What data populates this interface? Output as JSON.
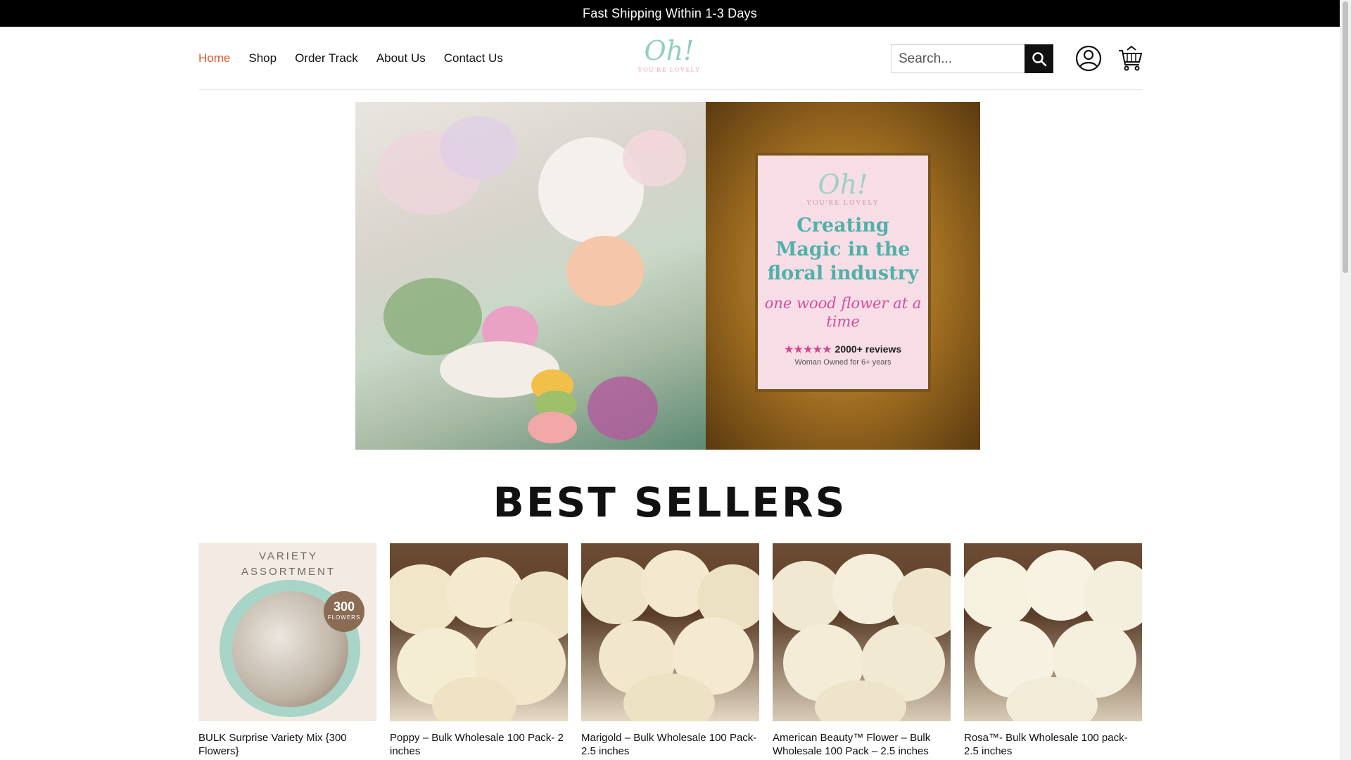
{
  "announcement": "Fast Shipping Within 1-3 Days",
  "nav": {
    "items": [
      {
        "label": "Home"
      },
      {
        "label": "Shop"
      },
      {
        "label": "Order Track"
      },
      {
        "label": "About Us"
      },
      {
        "label": "Contact Us"
      }
    ],
    "active_index": 0,
    "active_color": "#e05a2b"
  },
  "logo": {
    "mark": "Oh!",
    "sub": "YOU'RE LOVELY"
  },
  "search": {
    "placeholder": "Search..."
  },
  "icons": {
    "search": "search-icon",
    "account": "user-circle-icon",
    "cart": "cart-icon"
  },
  "hero": {
    "logo_mark": "Oh!",
    "logo_sub": "YOU'RE LOVELY",
    "headline": "Creating Magic in the floral industry",
    "script": "one wood flower at a time",
    "stars": "★★★★★",
    "reviews": "2000+ reviews",
    "owned": "Woman Owned for 6+ years"
  },
  "best_sellers": {
    "title": "BEST SELLERS",
    "products": [
      {
        "name": "BULK Surprise Variety Mix {300 Flowers}",
        "price": "",
        "badge": "300",
        "badge_sub": "FLOWERS",
        "caption": "VARIETY ASSORTMENT"
      },
      {
        "name": "Poppy – Bulk Wholesale 100 Pack- 2 inches",
        "price": ""
      },
      {
        "name": "Marigold – Bulk Wholesale 100 Pack- 2.5 inches",
        "price": ""
      },
      {
        "name": "American Beauty™ Flower – Bulk Wholesale 100 Pack – 2.5 inches",
        "price": ""
      },
      {
        "name": "Rosa™- Bulk Wholesale 100 pack- 2.5 inches",
        "price": ""
      }
    ]
  },
  "colors": {
    "accent": "#e05a2b",
    "topbar": "#000000"
  }
}
